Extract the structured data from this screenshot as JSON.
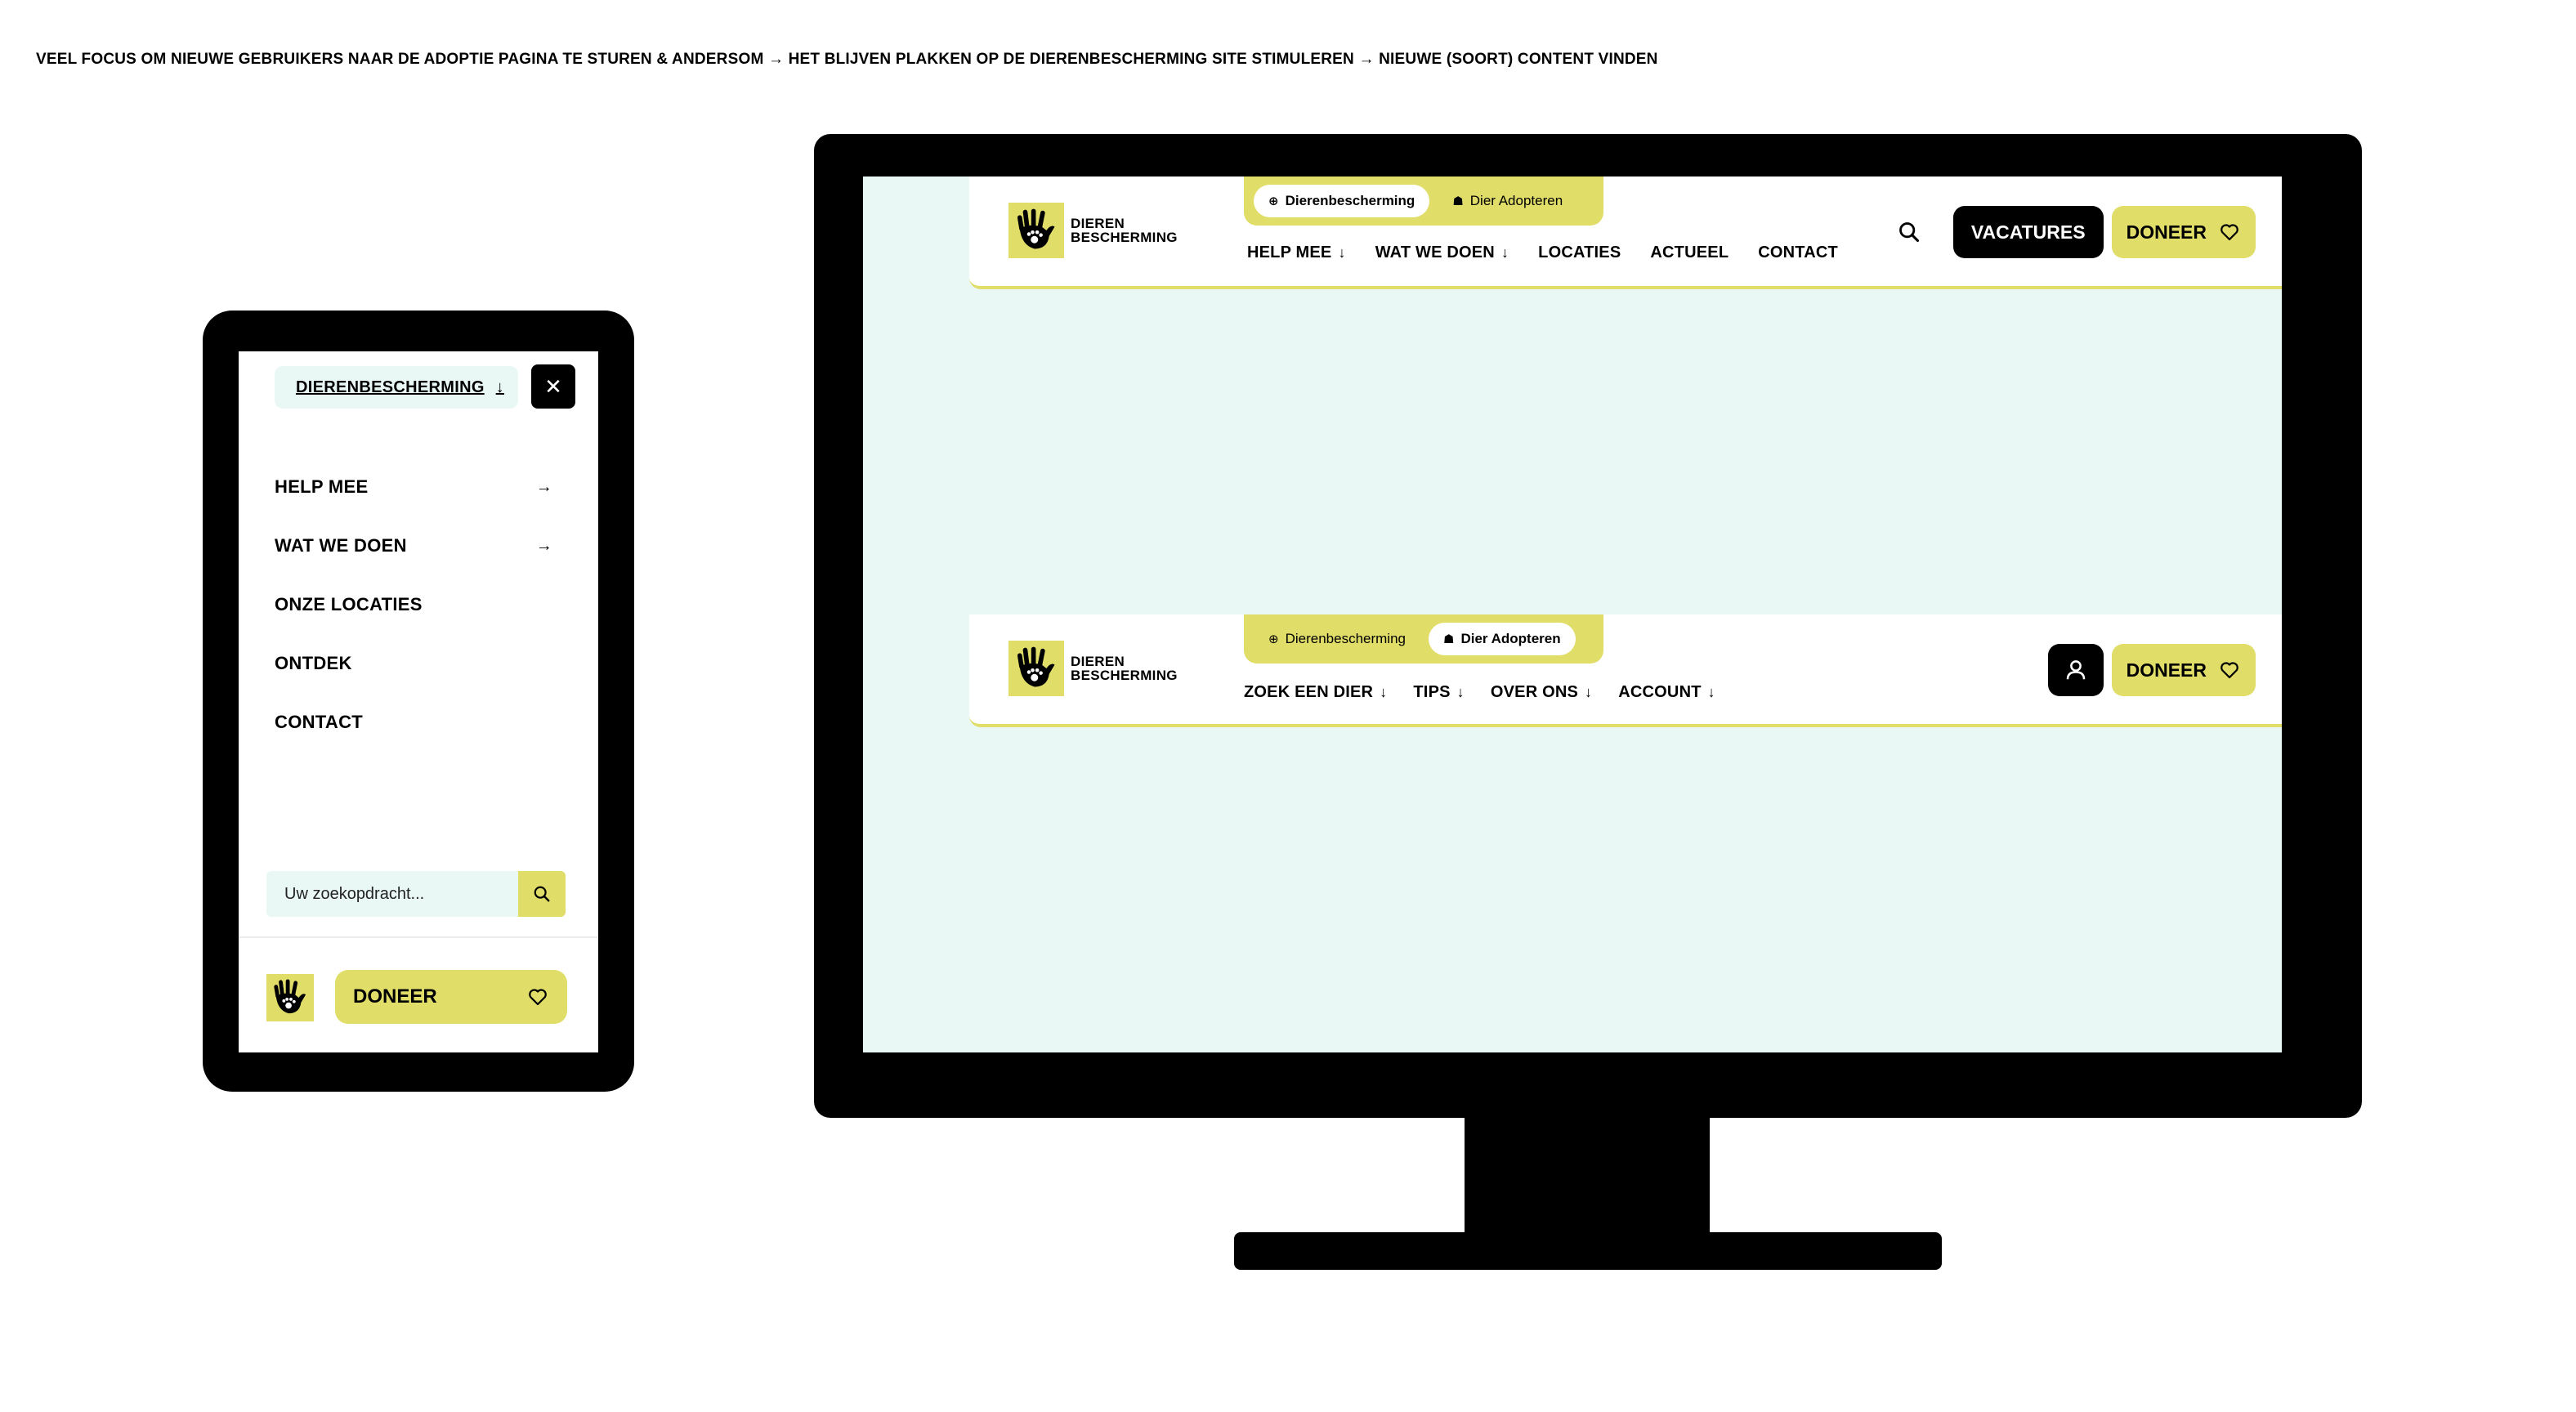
{
  "caption": "VEEL FOCUS OM NIEUWE GEBRUIKERS NAAR DE ADOPTIE PAGINA TE STUREN & ANDERSOM → HET BLIJVEN PLAKKEN OP DE DIERENBESCHERMING SITE STIMULEREN → NIEUWE (SOORT) CONTENT VINDEN",
  "brand": {
    "line1": "DIEREN",
    "line2": "BESCHERMING",
    "color": "#e0dd68",
    "icon": "hand-paw-logo-icon"
  },
  "mobile": {
    "site_selector": "DIERENBESCHERMING",
    "site_selector_arrow": "↓",
    "close_label": "✕",
    "menu": [
      {
        "label": "HELP MEE",
        "arrow": "→"
      },
      {
        "label": "WAT WE DOEN",
        "arrow": "→"
      },
      {
        "label": "ONZE LOCATIES",
        "arrow": ""
      },
      {
        "label": "ONTDEK",
        "arrow": ""
      },
      {
        "label": "CONTACT",
        "arrow": ""
      }
    ],
    "search_placeholder": "Uw zoekopdracht...",
    "donate_label": "DONEER"
  },
  "desktop_nav_1": {
    "tabs": [
      {
        "label": "Dierenbescherming",
        "icon": "globe-icon",
        "active": true
      },
      {
        "label": "Dier Adopteren",
        "icon": "paw-icon",
        "active": false
      }
    ],
    "menu": [
      {
        "label": "HELP MEE",
        "arrow": "↓"
      },
      {
        "label": "WAT WE DOEN",
        "arrow": "↓"
      },
      {
        "label": "LOCATIES",
        "arrow": ""
      },
      {
        "label": "ACTUEEL",
        "arrow": ""
      },
      {
        "label": "CONTACT",
        "arrow": ""
      }
    ],
    "vacatures_label": "VACATURES",
    "donate_label": "DONEER"
  },
  "desktop_nav_2": {
    "tabs": [
      {
        "label": "Dierenbescherming",
        "icon": "globe-icon",
        "active": false
      },
      {
        "label": "Dier Adopteren",
        "icon": "paw-icon",
        "active": true
      }
    ],
    "menu": [
      {
        "label": "ZOEK EEN DIER",
        "arrow": "↓"
      },
      {
        "label": "TIPS",
        "arrow": "↓"
      },
      {
        "label": "OVER ONS",
        "arrow": "↓"
      },
      {
        "label": "ACCOUNT",
        "arrow": "↓"
      }
    ],
    "donate_label": "DONEER"
  }
}
